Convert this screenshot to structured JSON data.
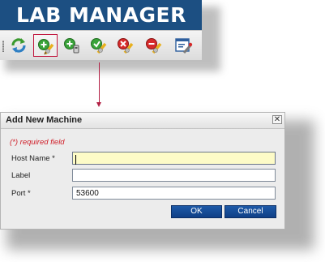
{
  "banner": {
    "title": "LAB MANAGER"
  },
  "toolbar": {
    "buttons": [
      {
        "name": "refresh-icon"
      },
      {
        "name": "add-machine-icon",
        "selected": true
      },
      {
        "name": "add-device-icon"
      },
      {
        "name": "edit-machine-icon"
      },
      {
        "name": "delete-machine-icon"
      },
      {
        "name": "remove-machine-icon"
      },
      {
        "name": "properties-icon"
      }
    ]
  },
  "dialog": {
    "title": "Add New Machine",
    "close_glyph": "✕",
    "required_note": "(*) required field",
    "fields": {
      "host_name": {
        "label": "Host Name *",
        "value": ""
      },
      "label": {
        "label": "Label",
        "value": ""
      },
      "port": {
        "label": "Port *",
        "value": "53600"
      }
    },
    "ok_label": "OK",
    "cancel_label": "Cancel"
  },
  "colors": {
    "banner_bg": "#1c4f82",
    "connector": "#b22044",
    "required_text": "#d0202a",
    "button_bg": "#1e5aa8",
    "focused_field_bg": "#fdfbc7"
  }
}
